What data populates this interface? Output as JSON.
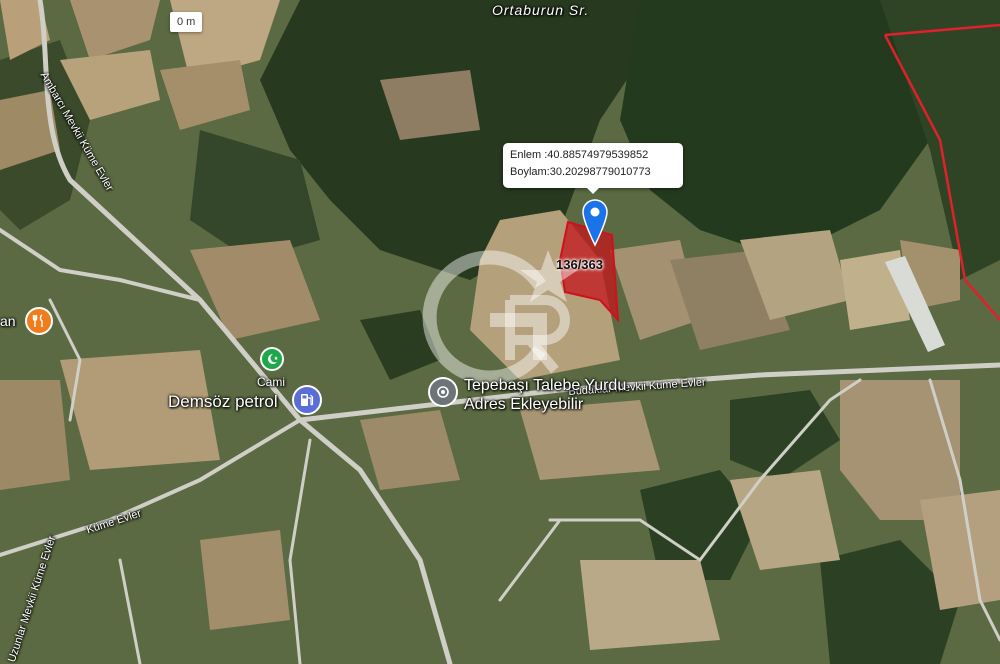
{
  "map": {
    "scale_label": "0 m",
    "tooltip": {
      "lat_line": "Enlem :40.88574979539852",
      "lon_line": "Boylam:30.20298779010773"
    },
    "parcel_label": "136/363",
    "roads": {
      "ortaburun": "Ortaburun Sr.",
      "ambarci": "Ambarcı Mevkii Küme Evler",
      "budaklar": "Budaklar Mevkii Küme Evler",
      "kume": "Küme Evler",
      "uzunlar": "Uzunlar Mevkii Küme Evler"
    },
    "places": {
      "restaurant_partial": "an",
      "cami": "Cami",
      "petrol": "Demsöz petrol",
      "yurdu_line1": "Tepebaşı Talebe Yurdu",
      "yurdu_line2": "Adres Ekleyebilir"
    },
    "colors": {
      "parcel": "#c4161c",
      "marker": "#1a73e8",
      "boundary": "#e0202a",
      "restaurant_pin": "#f07c1b",
      "mosque_pin": "#1fa84b",
      "fuel_pin": "#5b6dd6"
    },
    "icons": [
      "location-pin-icon",
      "restaurant-icon",
      "mosque-icon",
      "fuel-icon",
      "place-icon",
      "watermark-logo"
    ]
  }
}
